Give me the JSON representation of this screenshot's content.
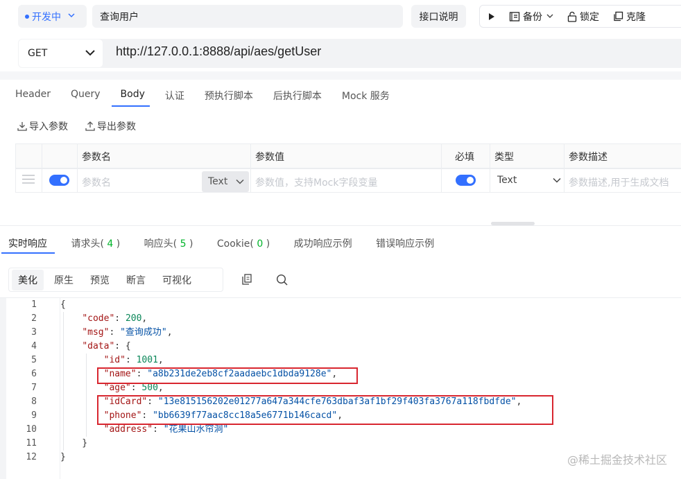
{
  "toolbar": {
    "env_label": "开发中",
    "api_name": "查询用户",
    "doc_button": "接口说明",
    "backup_label": "备份",
    "lock_label": "锁定",
    "clone_label": "克隆"
  },
  "request": {
    "method": "GET",
    "url": "http://127.0.0.1:8888/api/aes/getUser",
    "tabs": [
      "Header",
      "Query",
      "Body",
      "认证",
      "预执行脚本",
      "后执行脚本",
      "Mock 服务"
    ],
    "active_tab": "Body",
    "import_label": "导入参数",
    "export_label": "导出参数"
  },
  "params_table": {
    "headers": {
      "name": "参数名",
      "value": "参数值",
      "required": "必填",
      "type": "类型",
      "desc": "参数描述"
    },
    "row": {
      "name_placeholder": "参数名",
      "name_type": "Text",
      "value_placeholder": "参数值，支持Mock字段变量",
      "type": "Text",
      "desc_placeholder": "参数描述,用于生成文档"
    }
  },
  "response": {
    "tabs": {
      "realtime": "实时响应",
      "req_headers_label": "请求头",
      "req_headers_count": "4",
      "resp_headers_label": "响应头",
      "resp_headers_count": "5",
      "cookie_label": "Cookie",
      "cookie_count": "0",
      "success_example": "成功响应示例",
      "error_example": "错误响应示例"
    },
    "format_tabs": [
      "美化",
      "原生",
      "预览",
      "断言",
      "可视化"
    ],
    "active_format": "美化",
    "line_numbers": [
      "1",
      "2",
      "3",
      "4",
      "5",
      "6",
      "7",
      "8",
      "9",
      "10",
      "11",
      "12"
    ],
    "json": {
      "code_key": "\"code\"",
      "code_val": "200",
      "msg_key": "\"msg\"",
      "msg_val": "\"查询成功\"",
      "data_key": "\"data\"",
      "id_key": "\"id\"",
      "id_val": "1001",
      "name_key": "\"name\"",
      "name_val": "\"a8b231de2eb8cf2aadaebc1dbda9128e\"",
      "age_key": "\"age\"",
      "age_val": "500",
      "idcard_key": "\"idCard\"",
      "idcard_val": "\"13e815156202e01277a647a344cfe763dbaf3af1bf29f403fa3767a118fbdfde\"",
      "phone_key": "\"phone\"",
      "phone_val": "\"bb6639f77aac8cc18a5e6771b146cacd\"",
      "address_key": "\"address\"",
      "address_val": "\"花果山水帘洞\""
    }
  },
  "watermark": "@稀土掘金技术社区",
  "colors": {
    "accent": "#3370ff",
    "count_green": "#00b42a",
    "highlight_red": "#d8262f"
  }
}
